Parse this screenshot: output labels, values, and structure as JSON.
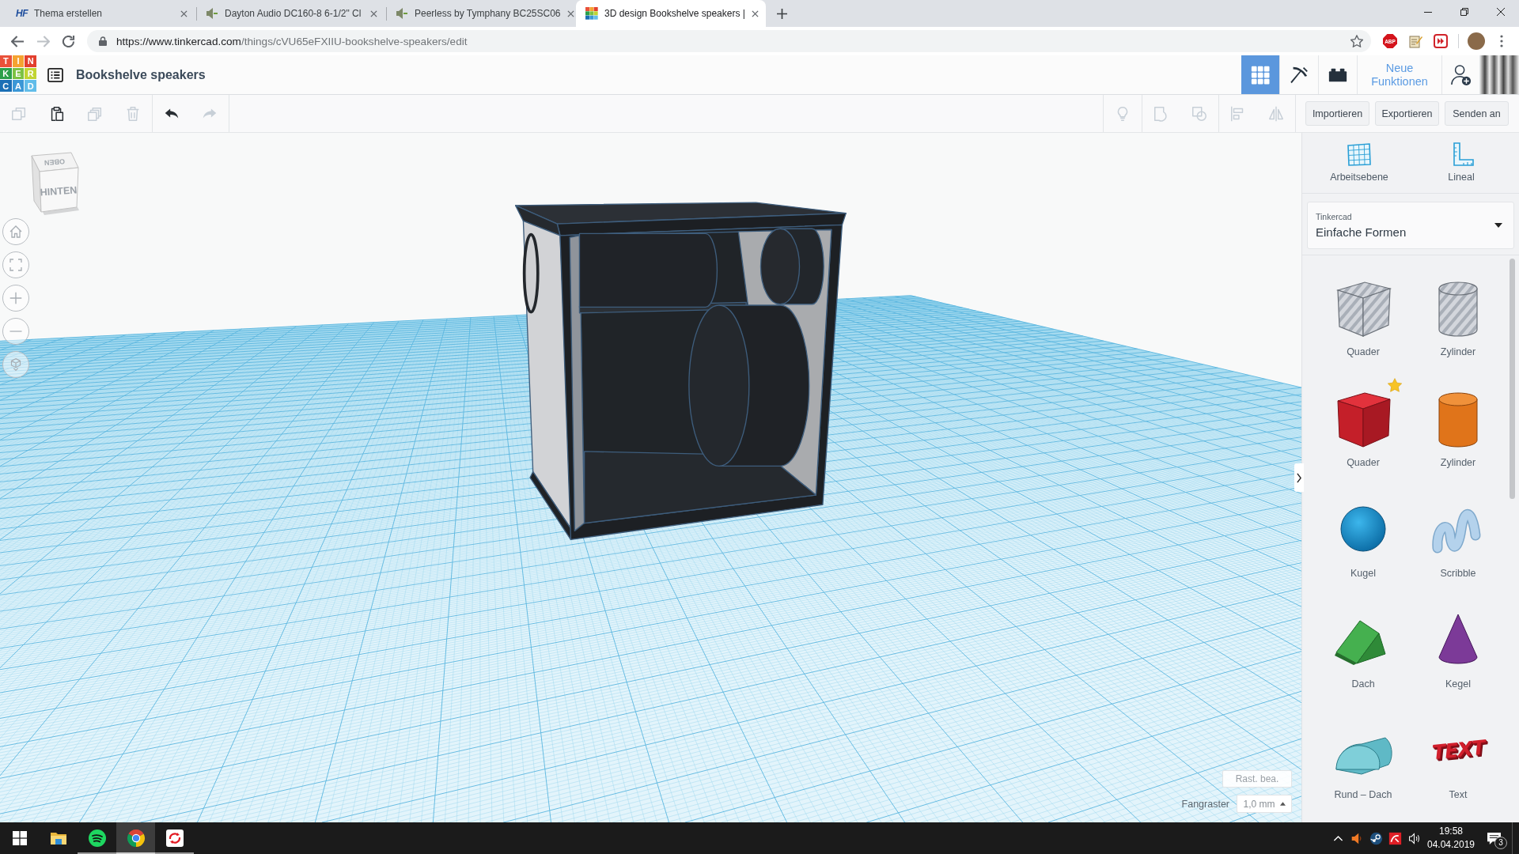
{
  "browser": {
    "tabs": [
      {
        "favicon": {
          "kind": "letters",
          "text": "HF"
        },
        "title": "Thema erstellen",
        "selected": false
      },
      {
        "favicon": {
          "kind": "driver"
        },
        "title": "Dayton Audio DC160-8 6-1/2\" Cl",
        "selected": false
      },
      {
        "favicon": {
          "kind": "driver"
        },
        "title": "Peerless by Tymphany BC25SC06",
        "selected": false
      },
      {
        "favicon": {
          "kind": "tile-grid"
        },
        "title": "3D design Bookshelve speakers |",
        "selected": true
      }
    ],
    "nav": [
      {
        "kind": "back",
        "disabled": false
      },
      {
        "kind": "forward",
        "disabled": true
      },
      {
        "kind": "reload",
        "disabled": false
      }
    ],
    "url": {
      "host": "https://www.tinkercad.com",
      "path": "/things/cVU65eFXIIU-bookshelve-speakers/edit"
    },
    "extensions": [
      {
        "kind": "adblock",
        "label": "ABP"
      },
      {
        "kind": "notepad"
      },
      {
        "kind": "fast-forward"
      }
    ]
  },
  "app": {
    "logo": [
      "T",
      "I",
      "N",
      "K",
      "E",
      "R",
      "C",
      "A",
      "D"
    ],
    "title": "Bookshelve speakers",
    "views": [
      {
        "kind": "grid",
        "selected": true
      },
      {
        "kind": "pickaxe",
        "selected": false
      },
      {
        "kind": "bricks",
        "selected": false
      }
    ],
    "new_features": "Neue Funktionen"
  },
  "toolbar": {
    "edit_tools": [
      [
        {
          "kind": "copy",
          "disabled": true
        },
        {
          "kind": "paste",
          "disabled": false
        },
        {
          "kind": "duplicate",
          "disabled": true
        },
        {
          "kind": "delete",
          "disabled": true
        }
      ],
      [
        {
          "kind": "undo",
          "disabled": false
        },
        {
          "kind": "redo",
          "disabled": true
        }
      ]
    ],
    "shape_tools": [
      [
        {
          "kind": "lightbulb",
          "disabled": true
        }
      ],
      [
        {
          "kind": "group",
          "disabled": true
        },
        {
          "kind": "ungroup",
          "disabled": true
        }
      ],
      [
        {
          "kind": "align",
          "disabled": true
        },
        {
          "kind": "mirror",
          "disabled": true
        }
      ]
    ],
    "buttons": [
      "Importieren",
      "Exportieren",
      "Senden an"
    ]
  },
  "workspace": {
    "view_cube": {
      "front": "HINTEN",
      "top": "OBEN"
    },
    "view_controls": [
      {
        "kind": "home"
      },
      {
        "kind": "fit"
      },
      {
        "kind": "zoom-in"
      },
      {
        "kind": "zoom-out"
      },
      {
        "kind": "perspective"
      }
    ],
    "edit_grid": "Rast. bea.",
    "snap_label": "Fangraster",
    "snap_value": "1,0 mm"
  },
  "panel": {
    "tools": [
      {
        "kind": "workplane",
        "label": "Arbeitsebene"
      },
      {
        "kind": "ruler",
        "label": "Lineal"
      }
    ],
    "library": {
      "caption": "Tinkercad",
      "value": "Einfache Formen"
    },
    "shapes": [
      {
        "kind": "box-hole",
        "label": "Quader",
        "starred": false
      },
      {
        "kind": "cylinder-hole",
        "label": "Zylinder",
        "starred": false
      },
      {
        "kind": "box",
        "label": "Quader",
        "starred": true
      },
      {
        "kind": "cylinder",
        "label": "Zylinder",
        "starred": false
      },
      {
        "kind": "sphere",
        "label": "Kugel",
        "starred": false
      },
      {
        "kind": "scribble",
        "label": "Scribble",
        "starred": false
      },
      {
        "kind": "roof",
        "label": "Dach",
        "starred": false
      },
      {
        "kind": "cone",
        "label": "Kegel",
        "starred": false
      },
      {
        "kind": "round-roof",
        "label": "Rund – Dach",
        "starred": false
      },
      {
        "kind": "text",
        "label": "Text",
        "preview": "TEXT",
        "starred": false
      }
    ]
  },
  "taskbar": {
    "apps": [
      {
        "kind": "explorer",
        "running": false,
        "selected": false
      },
      {
        "kind": "spotify",
        "running": true,
        "selected": false
      },
      {
        "kind": "chrome",
        "running": true,
        "selected": true
      },
      {
        "kind": "sync",
        "running": true,
        "selected": false
      }
    ],
    "tray": [
      {
        "kind": "chevron"
      },
      {
        "kind": "speaker-alert"
      },
      {
        "kind": "steam"
      },
      {
        "kind": "avira"
      },
      {
        "kind": "volume"
      }
    ],
    "time": "19:58",
    "date": "04.04.2019",
    "notifications": "3"
  }
}
